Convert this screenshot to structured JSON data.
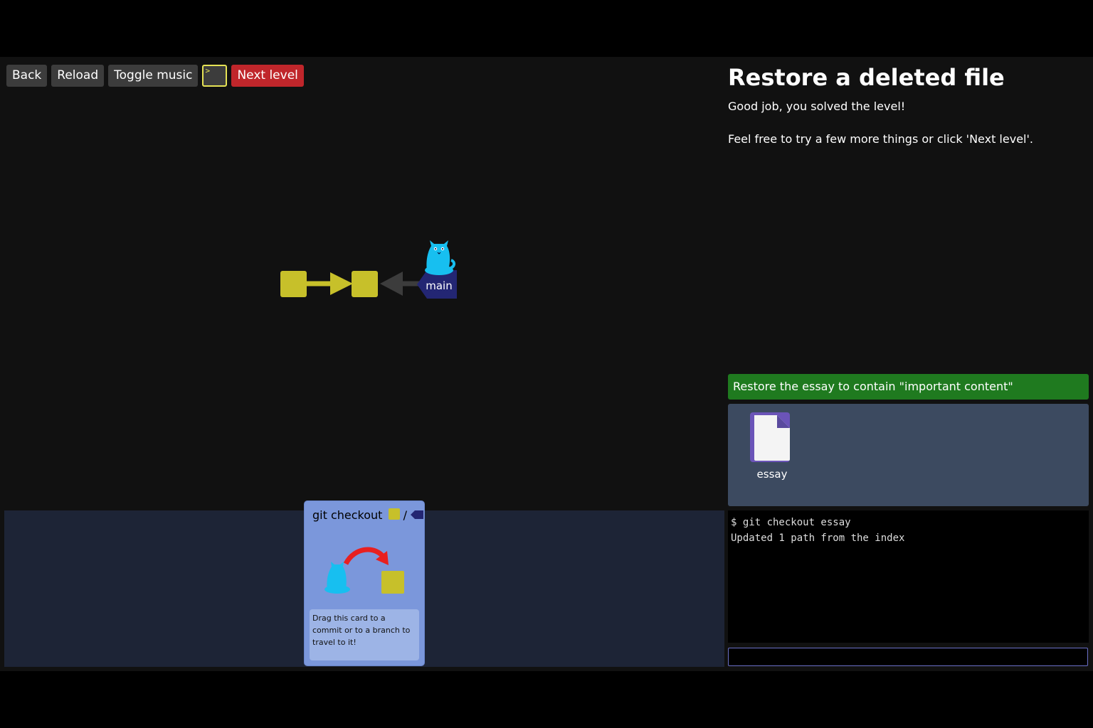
{
  "toolbar": {
    "back_label": "Back",
    "reload_label": "Reload",
    "toggle_music_label": "Toggle music",
    "terminal_icon": "terminal-icon",
    "next_level_label": "Next level"
  },
  "graph": {
    "commits": 2,
    "branch_label": "main",
    "head_icon": "cat-head-icon"
  },
  "level": {
    "title": "Restore a deleted file",
    "message1": "Good job, you solved the level!",
    "message2": "Feel free to try a few more things or click 'Next level'."
  },
  "goal": {
    "text": "Restore the essay to contain \"important content\""
  },
  "files": [
    {
      "name": "essay",
      "icon": "file-icon"
    }
  ],
  "card": {
    "title": "git checkout",
    "separator": "/",
    "description": "Drag this card to a commit or to a branch to travel to it!"
  },
  "terminal": {
    "lines": [
      "$ git checkout essay",
      "Updated 1 path from the index"
    ],
    "input_value": ""
  },
  "colors": {
    "commit": "#c7c02a",
    "branch": "#232673",
    "head": "#17bff0",
    "goal": "#1f7a1f",
    "next_level": "#c0262b",
    "card": "#7b97db"
  }
}
